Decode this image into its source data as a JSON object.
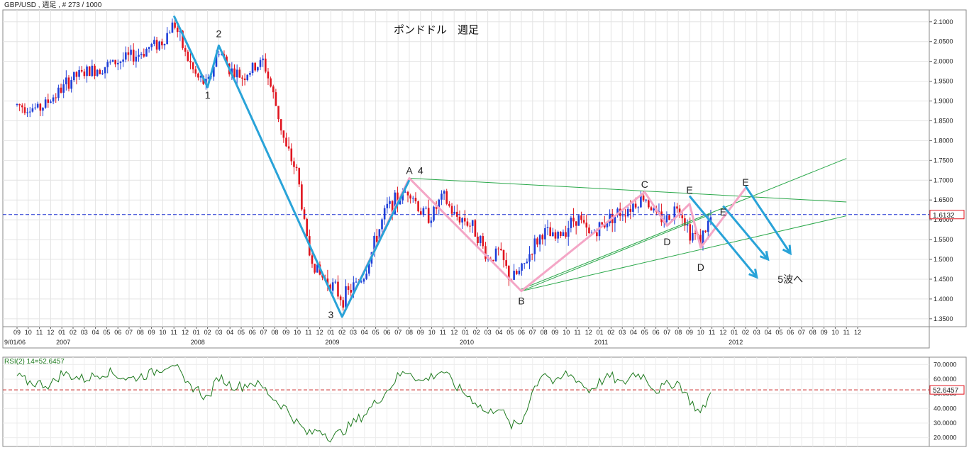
{
  "header": {
    "symbol_label": "GBP/USD , 週足 , # 273 / 1000"
  },
  "colors": {
    "up": "#1f3fd8",
    "down": "#e0141e",
    "impulse": "#29a3d8",
    "correction": "#f4a6c6",
    "trendline": "#2aa84a",
    "rsi": "#1e7a1e",
    "price_line": "#1a2fd0",
    "rsi_level": "#c81e1e"
  },
  "chart_data": [
    {
      "type": "candlestick",
      "title": "ポンドドル　週足",
      "xlabel": "",
      "ylabel": "",
      "ylim": [
        1.33,
        2.13
      ],
      "yticks": [
        "2.1000",
        "2.0500",
        "2.0000",
        "1.9500",
        "1.9000",
        "1.8500",
        "1.8000",
        "1.7500",
        "1.7000",
        "1.6500",
        "1.6000",
        "1.5500",
        "1.5000",
        "1.4500",
        "1.4000",
        "1.3500"
      ],
      "x_month_ticks": [
        "09",
        "10",
        "11",
        "12",
        "01",
        "02",
        "03",
        "04",
        "05",
        "06",
        "07",
        "08",
        "09",
        "10",
        "11",
        "12",
        "01",
        "02",
        "03",
        "04",
        "05",
        "06",
        "07",
        "08",
        "09",
        "10",
        "11",
        "12",
        "01",
        "02",
        "03",
        "04",
        "05",
        "06",
        "07",
        "08",
        "09",
        "10",
        "11",
        "12",
        "01",
        "02",
        "03",
        "04",
        "05",
        "06",
        "07",
        "08",
        "09",
        "10",
        "11",
        "12",
        "01",
        "02",
        "03",
        "04",
        "05",
        "06",
        "07",
        "08",
        "09",
        "10",
        "11",
        "12",
        "01",
        "02",
        "03",
        "04",
        "05",
        "06",
        "07",
        "08",
        "09",
        "10",
        "11",
        "12"
      ],
      "x_year_labels": [
        {
          "label": "9/01/06",
          "month": "2006-09"
        },
        {
          "label": "2007",
          "month": "2007-01"
        },
        {
          "label": "2008",
          "month": "2008-01"
        },
        {
          "label": "2009",
          "month": "2009-01"
        },
        {
          "label": "2010",
          "month": "2010-01"
        },
        {
          "label": "2011",
          "month": "2011-01"
        },
        {
          "label": "2012",
          "month": "2012-01"
        }
      ],
      "current_price": 1.6132,
      "current_price_label": "1.6132",
      "price_path": [
        [
          "2006-09",
          1.89
        ],
        [
          "2006-11",
          1.88
        ],
        [
          "2007-01",
          1.93
        ],
        [
          "2007-02",
          1.96
        ],
        [
          "2007-04",
          1.98
        ],
        [
          "2007-06",
          2.0
        ],
        [
          "2007-08",
          2.02
        ],
        [
          "2007-09",
          2.04
        ],
        [
          "2007-10",
          2.05
        ],
        [
          "2007-11",
          2.1
        ],
        [
          "2007-12",
          2.02
        ],
        [
          "2008-01",
          1.96
        ],
        [
          "2008-02",
          1.94
        ],
        [
          "2008-03",
          2.03
        ],
        [
          "2008-04",
          1.98
        ],
        [
          "2008-05",
          1.96
        ],
        [
          "2008-06",
          1.98
        ],
        [
          "2008-07",
          2.0
        ],
        [
          "2008-08",
          1.9
        ],
        [
          "2008-09",
          1.78
        ],
        [
          "2008-10",
          1.72
        ],
        [
          "2008-11",
          1.52
        ],
        [
          "2008-12",
          1.46
        ],
        [
          "2009-01",
          1.44
        ],
        [
          "2009-02",
          1.4
        ],
        [
          "2009-03",
          1.43
        ],
        [
          "2009-04",
          1.46
        ],
        [
          "2009-05",
          1.55
        ],
        [
          "2009-06",
          1.63
        ],
        [
          "2009-07",
          1.65
        ],
        [
          "2009-08",
          1.68
        ],
        [
          "2009-09",
          1.62
        ],
        [
          "2009-10",
          1.61
        ],
        [
          "2009-11",
          1.66
        ],
        [
          "2009-12",
          1.61
        ],
        [
          "2010-01",
          1.6
        ],
        [
          "2010-02",
          1.57
        ],
        [
          "2010-03",
          1.5
        ],
        [
          "2010-04",
          1.52
        ],
        [
          "2010-05",
          1.45
        ],
        [
          "2010-06",
          1.47
        ],
        [
          "2010-07",
          1.53
        ],
        [
          "2010-08",
          1.57
        ],
        [
          "2010-09",
          1.55
        ],
        [
          "2010-10",
          1.58
        ],
        [
          "2010-11",
          1.61
        ],
        [
          "2010-12",
          1.56
        ],
        [
          "2011-01",
          1.58
        ],
        [
          "2011-02",
          1.61
        ],
        [
          "2011-03",
          1.62
        ],
        [
          "2011-04",
          1.64
        ],
        [
          "2011-05",
          1.66
        ],
        [
          "2011-06",
          1.61
        ],
        [
          "2011-07",
          1.6
        ],
        [
          "2011-08",
          1.64
        ],
        [
          "2011-09",
          1.57
        ],
        [
          "2011-10",
          1.55
        ],
        [
          "2011-11",
          1.61
        ]
      ],
      "annotations": {
        "wave_labels": [
          {
            "text": "1",
            "month": "2008-02",
            "value": 1.915,
            "pos": "below"
          },
          {
            "text": "2",
            "month": "2008-03",
            "value": 2.07,
            "pos": "above"
          },
          {
            "text": "3",
            "month": "2009-01",
            "value": 1.36,
            "pos": "below"
          },
          {
            "text": "4",
            "month": "2009-09",
            "value": 1.725,
            "pos": "above"
          },
          {
            "text": "A",
            "month": "2009-08",
            "value": 1.725,
            "pos": "above"
          },
          {
            "text": "B",
            "month": "2010-06",
            "value": 1.395,
            "pos": "below"
          },
          {
            "text": "C",
            "month": "2011-05",
            "value": 1.69,
            "pos": "above"
          },
          {
            "text": "D",
            "month": "2011-07",
            "value": 1.545,
            "pos": "below"
          },
          {
            "text": "D",
            "month": "2011-10",
            "value": 1.48,
            "pos": "below"
          },
          {
            "text": "E",
            "month": "2011-09",
            "value": 1.675,
            "pos": "above"
          },
          {
            "text": "E",
            "month": "2011-12",
            "value": 1.62,
            "pos": "above"
          },
          {
            "text": "E",
            "month": "2012-02",
            "value": 1.695,
            "pos": "above"
          },
          {
            "text": "5波へ",
            "month": "2012-06",
            "value": 1.45,
            "pos": "center"
          }
        ],
        "impulse_path": [
          [
            "2007-11",
            2.115
          ],
          [
            "2008-02",
            1.935
          ],
          [
            "2008-03",
            2.04
          ],
          [
            "2009-02",
            1.355
          ],
          [
            "2009-08",
            1.7
          ]
        ],
        "correction_path": [
          [
            "2009-02",
            1.355
          ],
          [
            "2009-08",
            1.705
          ],
          [
            "2010-06",
            1.42
          ],
          [
            "2011-05",
            1.67
          ],
          [
            "2011-07",
            1.585
          ],
          [
            "2011-09",
            1.64
          ],
          [
            "2011-10",
            1.53
          ],
          [
            "2012-02",
            1.68
          ]
        ],
        "trendlines": [
          [
            [
              "2009-08",
              1.705
            ],
            [
              "2012-11",
              1.645
            ]
          ],
          [
            [
              "2010-06",
              1.425
            ],
            [
              "2012-11",
              1.755
            ]
          ],
          [
            [
              "2010-06",
              1.42
            ],
            [
              "2012-11",
              1.61
            ]
          ],
          [
            [
              "2010-06",
              1.42
            ],
            [
              "2011-11",
              1.615
            ]
          ]
        ],
        "down_arrows": [
          [
            [
              "2011-09",
              1.66
            ],
            [
              "2012-03",
              1.455
            ]
          ],
          [
            [
              "2011-12",
              1.635
            ],
            [
              "2012-04",
              1.5
            ]
          ],
          [
            [
              "2012-02",
              1.685
            ],
            [
              "2012-06",
              1.515
            ]
          ]
        ]
      }
    },
    {
      "type": "line",
      "title": "RSI(2) 14=52.6457",
      "series_name": "RSI",
      "ylim": [
        14,
        75
      ],
      "yticks": [
        "70.0000",
        "60.0000",
        "50.0000",
        "40.0000",
        "30.0000",
        "20.0000"
      ],
      "level": 52.6457,
      "level_label": "52.6457",
      "path": [
        [
          "2006-09",
          62
        ],
        [
          "2006-10",
          58
        ],
        [
          "2006-12",
          56
        ],
        [
          "2007-01",
          64
        ],
        [
          "2007-03",
          60
        ],
        [
          "2007-05",
          65
        ],
        [
          "2007-07",
          60
        ],
        [
          "2007-09",
          64
        ],
        [
          "2007-11",
          72
        ],
        [
          "2007-12",
          56
        ],
        [
          "2008-01",
          54
        ],
        [
          "2008-02",
          46
        ],
        [
          "2008-03",
          62
        ],
        [
          "2008-04",
          56
        ],
        [
          "2008-05",
          55
        ],
        [
          "2008-06",
          58
        ],
        [
          "2008-07",
          54
        ],
        [
          "2008-08",
          46
        ],
        [
          "2008-09",
          40
        ],
        [
          "2008-10",
          30
        ],
        [
          "2008-11",
          22
        ],
        [
          "2008-12",
          26
        ],
        [
          "2009-01",
          20
        ],
        [
          "2009-02",
          24
        ],
        [
          "2009-03",
          30
        ],
        [
          "2009-04",
          36
        ],
        [
          "2009-05",
          44
        ],
        [
          "2009-06",
          52
        ],
        [
          "2009-07",
          62
        ],
        [
          "2009-08",
          66
        ],
        [
          "2009-09",
          58
        ],
        [
          "2009-10",
          62
        ],
        [
          "2009-11",
          66
        ],
        [
          "2009-12",
          56
        ],
        [
          "2010-01",
          50
        ],
        [
          "2010-02",
          44
        ],
        [
          "2010-03",
          36
        ],
        [
          "2010-04",
          42
        ],
        [
          "2010-05",
          28
        ],
        [
          "2010-06",
          30
        ],
        [
          "2010-07",
          52
        ],
        [
          "2010-08",
          66
        ],
        [
          "2010-09",
          56
        ],
        [
          "2010-10",
          64
        ],
        [
          "2010-11",
          60
        ],
        [
          "2010-12",
          52
        ],
        [
          "2011-01",
          58
        ],
        [
          "2011-02",
          62
        ],
        [
          "2011-03",
          56
        ],
        [
          "2011-04",
          64
        ],
        [
          "2011-05",
          62
        ],
        [
          "2011-06",
          52
        ],
        [
          "2011-07",
          56
        ],
        [
          "2011-08",
          58
        ],
        [
          "2011-09",
          46
        ],
        [
          "2011-10",
          36
        ],
        [
          "2011-11",
          52.6
        ]
      ]
    }
  ]
}
